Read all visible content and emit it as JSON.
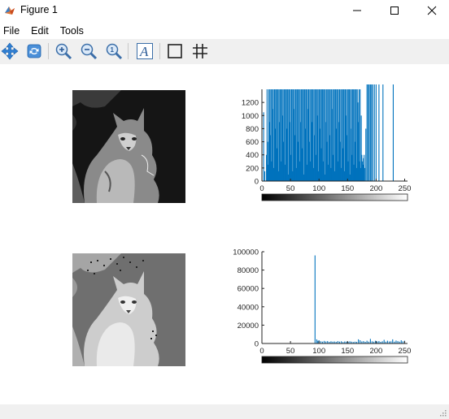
{
  "window": {
    "title": "Figure 1",
    "minimize_icon": "minimize-icon",
    "maximize_icon": "maximize-icon",
    "close_icon": "close-icon"
  },
  "menu": [
    "File",
    "Edit",
    "Tools"
  ],
  "toolbar": [
    {
      "name": "pan-tool",
      "icon": "move-arrows-icon"
    },
    {
      "name": "rotate-tool",
      "icon": "rotate-icon"
    },
    {
      "name": "zoom-in-tool",
      "icon": "zoom-in-icon"
    },
    {
      "name": "zoom-out-tool",
      "icon": "zoom-out-icon"
    },
    {
      "name": "zoom-reset-tool",
      "icon": "zoom-reset-icon"
    },
    {
      "name": "insert-text-tool",
      "icon": "italic-a-icon"
    },
    {
      "name": "axes-box-tool",
      "icon": "box-icon"
    },
    {
      "name": "grid-tool",
      "icon": "grid-icon"
    }
  ],
  "images": [
    {
      "name": "original-bobcat-image",
      "description_icon": "bobcat-grayscale-image"
    },
    {
      "name": "equalized-bobcat-image",
      "description_icon": "bobcat-equalized-image"
    }
  ],
  "chart_data": [
    {
      "type": "bar",
      "title": "",
      "xlabel": "",
      "ylabel": "",
      "xlim": [
        0,
        255
      ],
      "ylim": [
        0,
        1400
      ],
      "xticks": [
        "0",
        "50",
        "100",
        "150",
        "200",
        "250"
      ],
      "yticks": [
        "0",
        "200",
        "400",
        "600",
        "800",
        "1000",
        "1200"
      ],
      "bar_color": "#0072bd",
      "x": [
        3,
        5,
        8,
        9,
        10,
        11,
        12,
        13,
        14,
        15,
        16,
        17,
        18,
        19,
        20,
        21,
        22,
        23,
        24,
        25,
        26,
        27,
        28,
        29,
        30,
        31,
        32,
        33,
        34,
        35,
        36,
        37,
        38,
        39,
        40,
        41,
        42,
        43,
        44,
        45,
        46,
        47,
        48,
        49,
        50,
        51,
        52,
        53,
        54,
        55,
        56,
        57,
        58,
        59,
        60,
        61,
        62,
        63,
        64,
        65,
        66,
        67,
        68,
        69,
        70,
        71,
        72,
        73,
        74,
        75,
        76,
        77,
        78,
        79,
        80,
        81,
        82,
        83,
        84,
        85,
        86,
        87,
        88,
        89,
        90,
        91,
        92,
        93,
        94,
        95,
        96,
        97,
        98,
        99,
        100,
        101,
        102,
        103,
        104,
        105,
        106,
        107,
        108,
        109,
        110,
        111,
        112,
        113,
        114,
        115,
        116,
        117,
        118,
        119,
        120,
        121,
        122,
        123,
        124,
        125,
        126,
        127,
        128,
        129,
        130,
        131,
        132,
        133,
        134,
        135,
        136,
        137,
        138,
        139,
        140,
        141,
        142,
        143,
        144,
        145,
        146,
        147,
        148,
        149,
        150,
        151,
        152,
        153,
        154,
        155,
        156,
        157,
        158,
        159,
        160,
        161,
        162,
        163,
        164,
        165,
        166,
        167,
        168,
        169,
        170,
        171,
        172,
        173,
        174,
        175,
        176,
        177,
        178,
        179,
        180,
        182,
        184,
        186,
        188,
        190,
        192,
        194,
        197,
        200,
        205,
        212,
        230
      ],
      "values": [
        1050,
        150,
        400,
        1400,
        600,
        250,
        1400,
        900,
        1400,
        700,
        1400,
        300,
        1400,
        1100,
        1400,
        200,
        1400,
        800,
        1400,
        1400,
        500,
        1400,
        1400,
        150,
        1400,
        900,
        1400,
        1400,
        300,
        1400,
        1000,
        1400,
        600,
        1400,
        1400,
        250,
        1400,
        1400,
        800,
        1400,
        100,
        1400,
        1400,
        900,
        1400,
        400,
        1400,
        1400,
        150,
        1400,
        1100,
        1400,
        700,
        1400,
        200,
        1400,
        1400,
        600,
        1400,
        1400,
        300,
        1400,
        900,
        1400,
        500,
        1400,
        1400,
        100,
        1400,
        1400,
        800,
        1400,
        1400,
        250,
        1400,
        1100,
        1400,
        600,
        1400,
        300,
        1400,
        1400,
        900,
        1400,
        200,
        1400,
        700,
        1400,
        1400,
        400,
        1400,
        1000,
        1400,
        150,
        1400,
        1400,
        800,
        1400,
        500,
        1400,
        1400,
        300,
        1400,
        1400,
        100,
        1400,
        900,
        1400,
        600,
        1400,
        250,
        1400,
        1400,
        700,
        1400,
        200,
        1400,
        1100,
        1400,
        400,
        1400,
        1400,
        150,
        1400,
        800,
        1400,
        1400,
        300,
        1400,
        900,
        1400,
        600,
        1400,
        200,
        1400,
        1400,
        500,
        1400,
        1400,
        150,
        1400,
        1000,
        1400,
        700,
        1400,
        300,
        1400,
        1400,
        100,
        1400,
        800,
        1400,
        400,
        1400,
        1400,
        250,
        1400,
        600,
        1400,
        1400,
        200,
        1400,
        1200,
        900,
        1400,
        300,
        1400,
        200,
        1000,
        400,
        300,
        250,
        350,
        400,
        200,
        800
      ]
    },
    {
      "type": "bar",
      "title": "",
      "xlabel": "",
      "ylabel": "",
      "xlim": [
        0,
        255
      ],
      "ylim": [
        0,
        100000
      ],
      "xticks": [
        "0",
        "50",
        "100",
        "150",
        "200",
        "250"
      ],
      "yticks": [
        "0",
        "20000",
        "40000",
        "60000",
        "80000",
        "100000"
      ],
      "bar_color": "#0072bd",
      "x": [
        93,
        96,
        98,
        100,
        103,
        106,
        109,
        112,
        115,
        118,
        121,
        124,
        127,
        130,
        133,
        136,
        139,
        142,
        145,
        148,
        151,
        154,
        157,
        160,
        163,
        166,
        169,
        172,
        175,
        178,
        181,
        184,
        187,
        190,
        193,
        196,
        199,
        202,
        205,
        208,
        211,
        214,
        217,
        220,
        223,
        226,
        229,
        232,
        235,
        238,
        241,
        244,
        247,
        250
      ],
      "values": [
        96000,
        4500,
        3000,
        3500,
        2500,
        2000,
        2800,
        2200,
        2600,
        1800,
        2400,
        2000,
        2200,
        1800,
        2600,
        2000,
        2400,
        1600,
        2200,
        2000,
        1800,
        2400,
        2000,
        1600,
        2000,
        1800,
        4500,
        3500,
        2200,
        2600,
        1800,
        3000,
        2000,
        5000,
        2400,
        2000,
        3000,
        2200,
        2600,
        1800,
        2400,
        4000,
        2000,
        3000,
        2200,
        2400,
        4500,
        2000,
        3200,
        2600,
        2000,
        3500,
        2400,
        3000
      ]
    }
  ]
}
